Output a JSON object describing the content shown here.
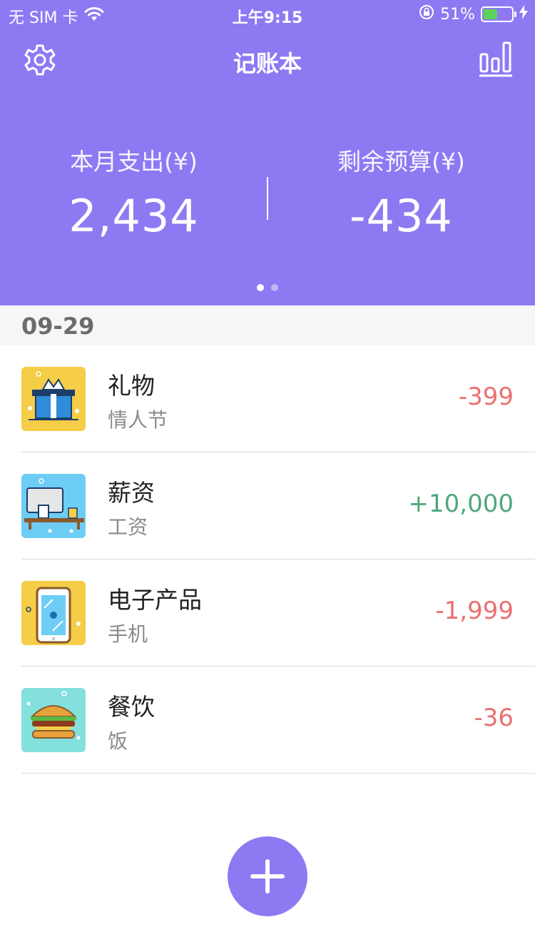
{
  "status_bar": {
    "carrier": "无 SIM 卡",
    "time": "上午9:15",
    "battery_percent": "51%",
    "battery_level": 0.51,
    "wifi_icon": "wifi-icon",
    "lock_icon": "orientation-lock-icon",
    "charging_icon": "charging-bolt-icon"
  },
  "nav": {
    "title": "记账本",
    "settings_icon": "gear-icon",
    "stats_icon": "bar-chart-icon"
  },
  "summary": {
    "expense_label": "本月支出(¥)",
    "expense_value": "2,434",
    "budget_label": "剩余预算(¥)",
    "budget_value": "-434",
    "pages": 2,
    "active_page": 1
  },
  "date": "09-29",
  "records": [
    {
      "title": "礼物",
      "note": "情人节",
      "amount": "-399",
      "type": "expense",
      "icon": "gift-icon",
      "icon_bg": "#F5CD47"
    },
    {
      "title": "薪资",
      "note": "工资",
      "amount": "+10,000",
      "type": "income",
      "icon": "computer-desk-icon",
      "icon_bg": "#6ECDF5"
    },
    {
      "title": "电子产品",
      "note": "手机",
      "amount": "-1,999",
      "type": "expense",
      "icon": "smartphone-icon",
      "icon_bg": "#F5CD47"
    },
    {
      "title": "餐饮",
      "note": "饭",
      "amount": "-36",
      "type": "expense",
      "icon": "burger-icon",
      "icon_bg": "#83E0DD"
    }
  ],
  "colors": {
    "primary": "#8E79F3",
    "expense": "#EB6F6F",
    "income": "#4FA878"
  },
  "fab_icon": "plus-icon"
}
